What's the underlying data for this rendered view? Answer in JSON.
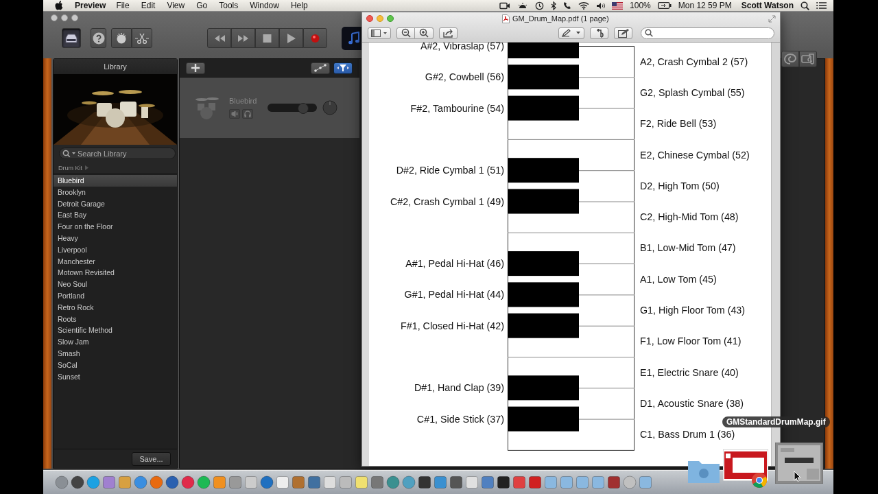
{
  "menu_bar": {
    "app": "Preview",
    "menus": [
      "File",
      "Edit",
      "View",
      "Go",
      "Tools",
      "Window",
      "Help"
    ],
    "battery": "100%",
    "clock": "Mon 12 59 PM",
    "user": "Scott Watson"
  },
  "garageband": {
    "library": {
      "title": "Library",
      "search": {
        "placeholder": "Search Library"
      },
      "breadcrumb": "Drum Kit",
      "items": [
        {
          "label": "Bluebird",
          "selected": true
        },
        {
          "label": "Brooklyn",
          "selected": false
        },
        {
          "label": "Detroit Garage",
          "selected": false
        },
        {
          "label": "East Bay",
          "selected": false
        },
        {
          "label": "Four on the Floor",
          "selected": false
        },
        {
          "label": "Heavy",
          "selected": false
        },
        {
          "label": "Liverpool",
          "selected": false
        },
        {
          "label": "Manchester",
          "selected": false
        },
        {
          "label": "Motown Revisited",
          "selected": false
        },
        {
          "label": "Neo Soul",
          "selected": false
        },
        {
          "label": "Portland",
          "selected": false
        },
        {
          "label": "Retro Rock",
          "selected": false
        },
        {
          "label": "Roots",
          "selected": false
        },
        {
          "label": "Scientific Method",
          "selected": false
        },
        {
          "label": "Slow Jam",
          "selected": false
        },
        {
          "label": "Smash",
          "selected": false
        },
        {
          "label": "SoCal",
          "selected": false
        },
        {
          "label": "Sunset",
          "selected": false
        }
      ],
      "save_button": "Save..."
    },
    "track": {
      "name": "Bluebird",
      "volume": {
        "level": 0.72
      }
    }
  },
  "preview": {
    "title": "GM_Drum_Map.pdf (1 page)",
    "keys": [
      {
        "kind": "black",
        "label": "A#2, Vibraslap (57)"
      },
      {
        "kind": "white",
        "label": "A2, Crash Cymbal 2 (57)"
      },
      {
        "kind": "black",
        "label": "G#2, Cowbell (56)"
      },
      {
        "kind": "white",
        "label": "G2, Splash Cymbal (55)"
      },
      {
        "kind": "black",
        "label": "F#2, Tambourine (54)"
      },
      {
        "kind": "white",
        "label": "F2, Ride Bell (53)"
      },
      {
        "kind": "white",
        "label": "E2, Chinese Cymbal (52)"
      },
      {
        "kind": "black",
        "label": "D#2, Ride Cymbal 1 (51)"
      },
      {
        "kind": "white",
        "label": "D2, High Tom (50)"
      },
      {
        "kind": "black",
        "label": "C#2, Crash Cymbal 1 (49)"
      },
      {
        "kind": "white",
        "label": "C2, High-Mid Tom (48)"
      },
      {
        "kind": "white",
        "label": "B1, Low-Mid Tom (47)"
      },
      {
        "kind": "black",
        "label": "A#1, Pedal Hi-Hat (46)"
      },
      {
        "kind": "white",
        "label": "A1, Low Tom (45)"
      },
      {
        "kind": "black",
        "label": "G#1, Pedal Hi-Hat (44)"
      },
      {
        "kind": "white",
        "label": "G1, High Floor Tom (43)"
      },
      {
        "kind": "black",
        "label": "F#1, Closed Hi-Hat (42)"
      },
      {
        "kind": "white",
        "label": "F1, Low Floor Tom (41)"
      },
      {
        "kind": "white",
        "label": "E1, Electric Snare (40)"
      },
      {
        "kind": "black",
        "label": "D#1, Hand Clap (39)"
      },
      {
        "kind": "white",
        "label": "D1, Acoustic Snare (38)"
      },
      {
        "kind": "black",
        "label": "C#1, Side Stick (37)"
      },
      {
        "kind": "white",
        "label": "C1, Bass Drum 1 (36)"
      }
    ]
  },
  "dock": {
    "tooltip": "GMStandardDrumMap.gif"
  }
}
